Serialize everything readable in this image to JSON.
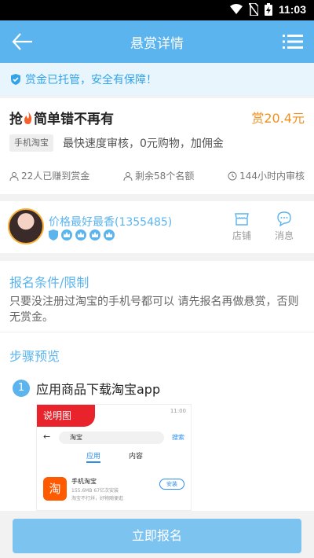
{
  "status_bar": {
    "time": "11:03",
    "icons": [
      "wifi-icon",
      "no-sim-icon",
      "battery-icon"
    ]
  },
  "nav": {
    "title": "悬赏详情",
    "back_icon": "back-arrow-icon",
    "menu_icon": "list-menu-icon"
  },
  "notice": {
    "icon": "shield-check-icon",
    "text": "赏金已托管，安全有保障！"
  },
  "task": {
    "title_prefix": "抢",
    "title_icon": "fire-icon",
    "title": "简单错不再有",
    "reward": "赏20.4元",
    "app_tag": "手机淘宝",
    "description": "最快速度审核，0元购物，加佣金",
    "stats": [
      {
        "icon": "users-icon",
        "text": "22人已赚到赏金"
      },
      {
        "icon": "person-icon",
        "text": "剩余58个名额"
      },
      {
        "icon": "clock-icon",
        "text": "144小时内审核"
      }
    ]
  },
  "publisher": {
    "name": "价格最好最香(1355485)",
    "badges": [
      "shield-badge-icon",
      "crown-badge-icon",
      "crown-badge-icon",
      "crown-badge-icon",
      "crown-badge-icon"
    ],
    "shop_label": "店铺",
    "message_label": "消息"
  },
  "conditions": {
    "title": "报名条件/限制",
    "text": "只要没注册过淘宝的手机号都可以 请先报名再做悬赏，否则无赏金。"
  },
  "steps": {
    "title": "步骤预览",
    "items": [
      {
        "number": "1",
        "label": "应用商品下载淘宝app"
      }
    ],
    "preview": {
      "ribbon": "说明图",
      "time": "11:00",
      "search_text": "淘宝",
      "search_button": "搜索",
      "tab_active": "应用",
      "tab_other": "内容",
      "app_logo_char": "淘",
      "app_name": "手机淘宝",
      "app_meta": "155.6MB  67亿次安装",
      "app_desc": "淘宝不打烊，好物随便逛",
      "install_label": "安装"
    }
  },
  "signup_button": "立即报名",
  "colors": {
    "primary": "#5bb4ee",
    "reward": "#f18f1c",
    "button": "#7cc3f0",
    "ribbon": "#e8232b"
  }
}
